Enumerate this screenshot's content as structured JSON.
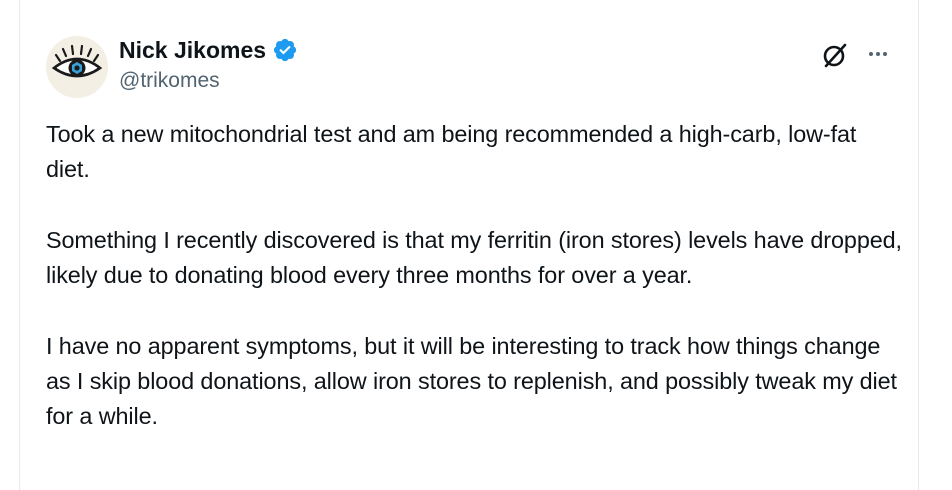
{
  "author": {
    "name": "Nick Jikomes",
    "handle": "@trikomes",
    "verified": true,
    "avatar_icon": "eye-logo-icon"
  },
  "actions": {
    "grok_icon": "grok-icon",
    "more_icon": "more-options-icon"
  },
  "tweet": {
    "paragraphs": [
      "Took a new mitochondrial test and am being recommended a high-carb, low-fat diet.",
      "Something I recently discovered is that my ferritin (iron stores) levels have dropped, likely due to donating blood every three months for over a year.",
      "I have no apparent symptoms, but it will be interesting to track how things change as I skip blood donations, allow iron stores to replenish, and possibly tweak my diet for a while."
    ]
  },
  "colors": {
    "text": "#0f1419",
    "secondary": "#536471",
    "verified": "#1d9bf0",
    "border": "#e7e9ea"
  }
}
